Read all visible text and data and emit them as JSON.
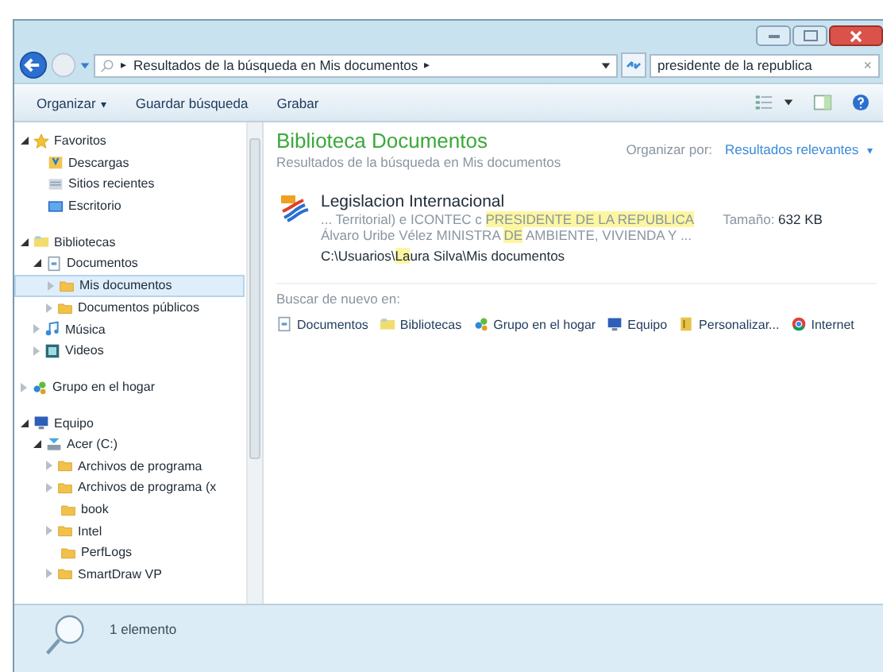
{
  "address_bar": {
    "breadcrumb": "Resultados de la búsqueda en Mis documentos",
    "separator": "▸",
    "trail": "▸"
  },
  "search": {
    "value": "presidente de la republica",
    "clear": "×"
  },
  "toolbar": {
    "items": [
      {
        "label": "Organizar",
        "arrow": "▾"
      },
      {
        "label": "Guardar búsqueda"
      },
      {
        "label": "Grabar"
      }
    ]
  },
  "nav": {
    "items": [
      {
        "label": "Favoritos",
        "kind": "star",
        "expanded": true,
        "selected": false,
        "children": [
          {
            "label": "Descargas",
            "kind": "downloads",
            "selected": false
          },
          {
            "label": "Sitios recientes",
            "kind": "recent",
            "selected": false
          },
          {
            "label": "Escritorio",
            "kind": "desktop",
            "selected": false
          }
        ]
      },
      {
        "label": "Bibliotecas",
        "kind": "library",
        "expanded": true,
        "selected": false,
        "children": [
          {
            "label": "Documentos",
            "kind": "document",
            "expanded": true,
            "selected": false,
            "children": [
              {
                "label": "Mis documentos",
                "kind": "folder",
                "expanded": false,
                "selected": true
              },
              {
                "label": "Documentos públicos",
                "kind": "folder",
                "expanded": false,
                "selected": false
              }
            ]
          },
          {
            "label": "Música",
            "kind": "music",
            "expanded": false,
            "selected": false
          },
          {
            "label": "Videos",
            "kind": "video",
            "expanded": false,
            "selected": false
          }
        ]
      },
      {
        "label": "Grupo en el hogar",
        "kind": "homegroup",
        "expanded": false,
        "selected": false
      },
      {
        "label": "Equipo",
        "kind": "computer",
        "expanded": true,
        "selected": false,
        "children": [
          {
            "label": "Acer (C:)",
            "kind": "drive",
            "expanded": true,
            "selected": false,
            "children": [
              {
                "label": "Archivos de programa",
                "kind": "folder",
                "expanded": false,
                "selected": false
              },
              {
                "label": "Archivos de programa (x",
                "kind": "folder",
                "expanded": false,
                "selected": false
              },
              {
                "label": "book",
                "kind": "folder",
                "selected": false
              },
              {
                "label": "Intel",
                "kind": "folder",
                "expanded": false,
                "selected": false
              },
              {
                "label": "PerfLogs",
                "kind": "folder",
                "selected": false
              },
              {
                "label": "SmartDraw VP",
                "kind": "folder",
                "expanded": false,
                "selected": false
              }
            ]
          }
        ]
      }
    ]
  },
  "content": {
    "title": "Biblioteca Documentos",
    "subtitle": "Resultados de la búsqueda en Mis documentos",
    "arrange_label": "Organizar por:",
    "arrange_value": "Resultados relevantes",
    "arrange_arrow": "▾",
    "results": [
      {
        "name": "Legislacion Internacional",
        "snippet_1": [
          {
            "text": "... Territorial) e ICONTEC c ",
            "highlighted": false
          },
          {
            "text": "PRESIDENTE DE LA REPUBLICA",
            "highlighted": true
          }
        ],
        "snippet_2": [
          {
            "text": "Álvaro Uribe Vélez MINISTRA ",
            "highlighted": false
          },
          {
            "text": "DE",
            "highlighted": true
          },
          {
            "text": " AMBIENTE, VIVIENDA Y ...",
            "highlighted": false
          }
        ],
        "path": [
          {
            "text": "C:\\Usuarios\\",
            "highlighted": false
          },
          {
            "text": "La",
            "highlighted": true
          },
          {
            "text": "ura Silva\\Mis documentos",
            "highlighted": false
          }
        ],
        "size_label": "Tamaño:",
        "size_value": "632 KB"
      }
    ],
    "search_again_label": "Buscar de nuevo en:",
    "search_again": [
      {
        "label": "Documentos",
        "kind": "document"
      },
      {
        "label": "Bibliotecas",
        "kind": "library"
      },
      {
        "label": "Grupo en el hogar",
        "kind": "homegroup"
      },
      {
        "label": "Equipo",
        "kind": "computer"
      },
      {
        "label": "Personalizar...",
        "kind": "custom"
      },
      {
        "label": "Internet",
        "kind": "globe"
      }
    ]
  },
  "status_bar": {
    "text": "1 elemento"
  }
}
